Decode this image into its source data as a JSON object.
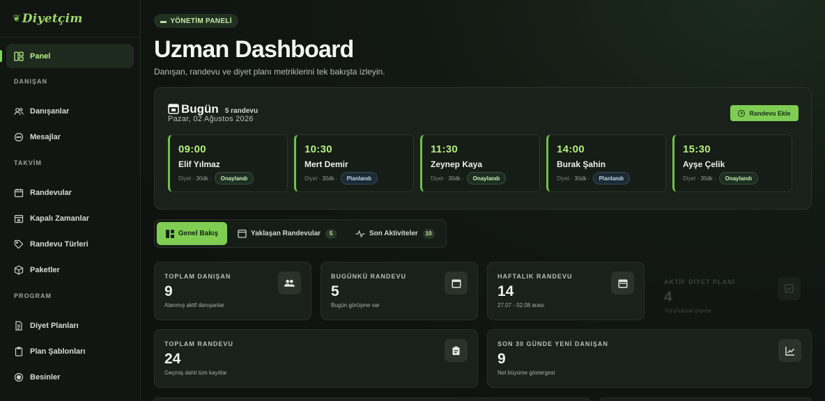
{
  "brand": {
    "name": "Diyetçim"
  },
  "sidebar": {
    "items": [
      {
        "label": "Panel",
        "icon": "dashboard-icon"
      },
      {
        "label": "Danışanlar",
        "icon": "users-icon"
      },
      {
        "label": "Mesajlar",
        "icon": "chat-icon"
      },
      {
        "label": "Randevular",
        "icon": "calendar-icon"
      },
      {
        "label": "Kapalı Zamanlar",
        "icon": "calendar-blocked-icon"
      },
      {
        "label": "Randevu Türleri",
        "icon": "tag-icon"
      },
      {
        "label": "Paketler",
        "icon": "package-icon"
      },
      {
        "label": "Diyet Planları",
        "icon": "document-icon"
      },
      {
        "label": "Plan Şablonları",
        "icon": "clipboard-icon"
      },
      {
        "label": "Besinler",
        "icon": "food-icon"
      }
    ],
    "sections": [
      "DANIŞAN",
      "TAKVİM",
      "PROGRAM"
    ]
  },
  "header": {
    "badge": "YÖNETİM PANELİ",
    "title": "Uzman Dashboard",
    "subtitle": "Danışan, randevu ve diyet planı metriklerini tek bakışta izleyin."
  },
  "today": {
    "title": "Bugün",
    "count": "5 randevu",
    "date": "Pazar, 02 Ağustos 2026",
    "add_label": "Randevu Ekle",
    "appointments": [
      {
        "time": "09:00",
        "name": "Elif Yılmaz",
        "type": "Diyet",
        "duration": "30dk",
        "status": "Onaylandı"
      },
      {
        "time": "10:30",
        "name": "Mert Demir",
        "type": "Diyet",
        "duration": "30dk",
        "status": "Planlandı"
      },
      {
        "time": "11:30",
        "name": "Zeynep Kaya",
        "type": "Diyet",
        "duration": "30dk",
        "status": "Onaylandı"
      },
      {
        "time": "14:00",
        "name": "Burak Şahin",
        "type": "Diyet",
        "duration": "30dk",
        "status": "Planlandı"
      },
      {
        "time": "15:30",
        "name": "Ayşe Çelik",
        "type": "Diyet",
        "duration": "30dk",
        "status": "Onaylandı"
      }
    ]
  },
  "tabs": [
    {
      "label": "Genel Bakış"
    },
    {
      "label": "Yaklaşan Randevular",
      "count": "5"
    },
    {
      "label": "Son Aktiviteler",
      "count": "10"
    }
  ],
  "stats": [
    {
      "label": "TOPLAM DANIŞAN",
      "value": "9",
      "desc": "Atanmış aktif danışanlar"
    },
    {
      "label": "BUGÜNKÜ RANDEVU",
      "value": "5",
      "desc": "Bugün görüşme var"
    },
    {
      "label": "HAFTALIK RANDEVU",
      "value": "14",
      "desc": "27.07 - 02.08 arası"
    },
    {
      "label": "AKTİF DİYET PLANI",
      "value": "4",
      "desc": "Yürürlükteki planlar"
    },
    {
      "label": "TOPLAM RANDEVU",
      "value": "24",
      "desc": "Geçmiş dahil tüm kayıtlar"
    },
    {
      "label": "SON 30 GÜNDE YENİ DANIŞAN",
      "value": "9",
      "desc": "Net büyüme göstergesi"
    }
  ],
  "colors": {
    "accent": "#7fcd53",
    "accent_text": "#b2f07e",
    "background": "#0f1310"
  }
}
